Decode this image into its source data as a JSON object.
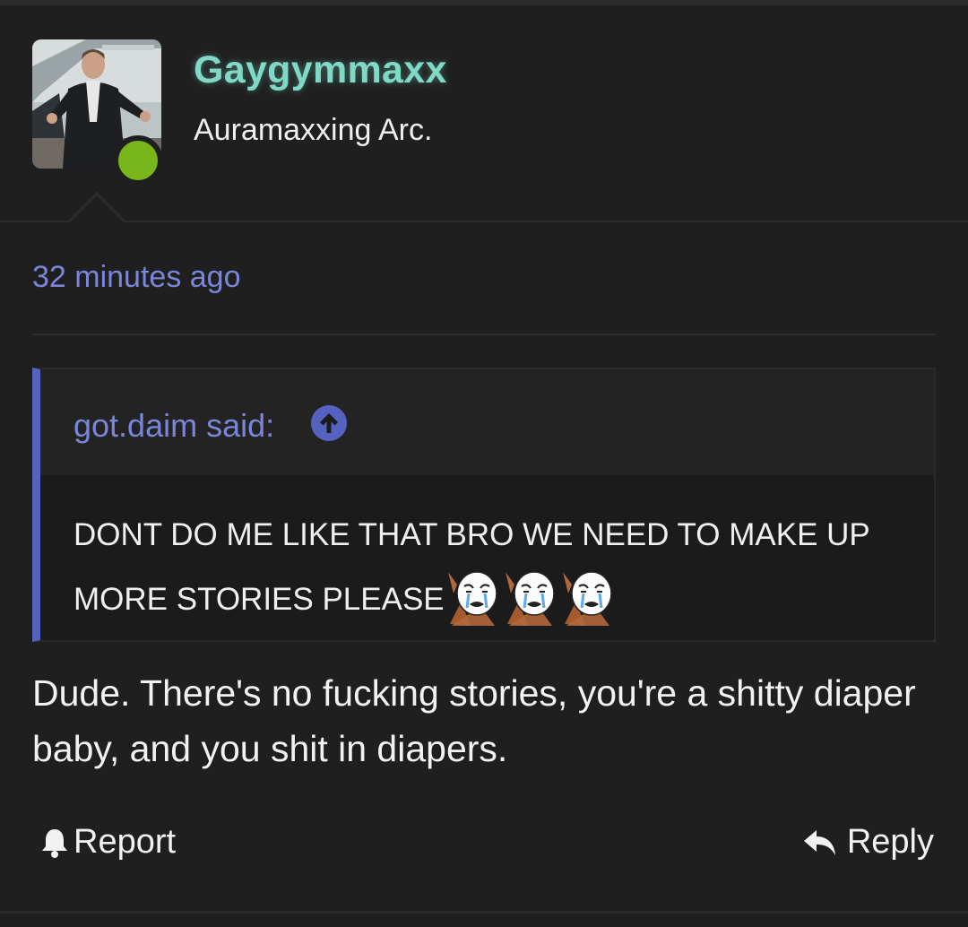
{
  "post": {
    "username": "Gaygymmaxx",
    "user_title": "Auramaxxing Arc.",
    "online_status": "online",
    "online_color": "#78b61c",
    "username_color": "#7fd9c4",
    "avatar_icon": "user-avatar-photo",
    "timestamp": "32 minutes ago",
    "quote": {
      "author_label": "got.daim said:",
      "jump_icon": "arrow-up-circle-icon",
      "text": "DONT DO ME LIKE THAT BRO WE NEED TO MAKE UP MORE STORIES PLEASE",
      "emoji_icons": [
        "crying-face-emoji",
        "crying-face-emoji",
        "crying-face-emoji"
      ]
    },
    "message": "Dude. There's no fucking stories, you're a shitty diaper baby, and you shit in diapers.",
    "actions": {
      "report_label": "Report",
      "report_icon": "bell-icon",
      "reply_label": "Reply",
      "reply_icon": "reply-arrow-icon"
    },
    "accent_color": "#5563c0",
    "link_color": "#7a86d8"
  }
}
